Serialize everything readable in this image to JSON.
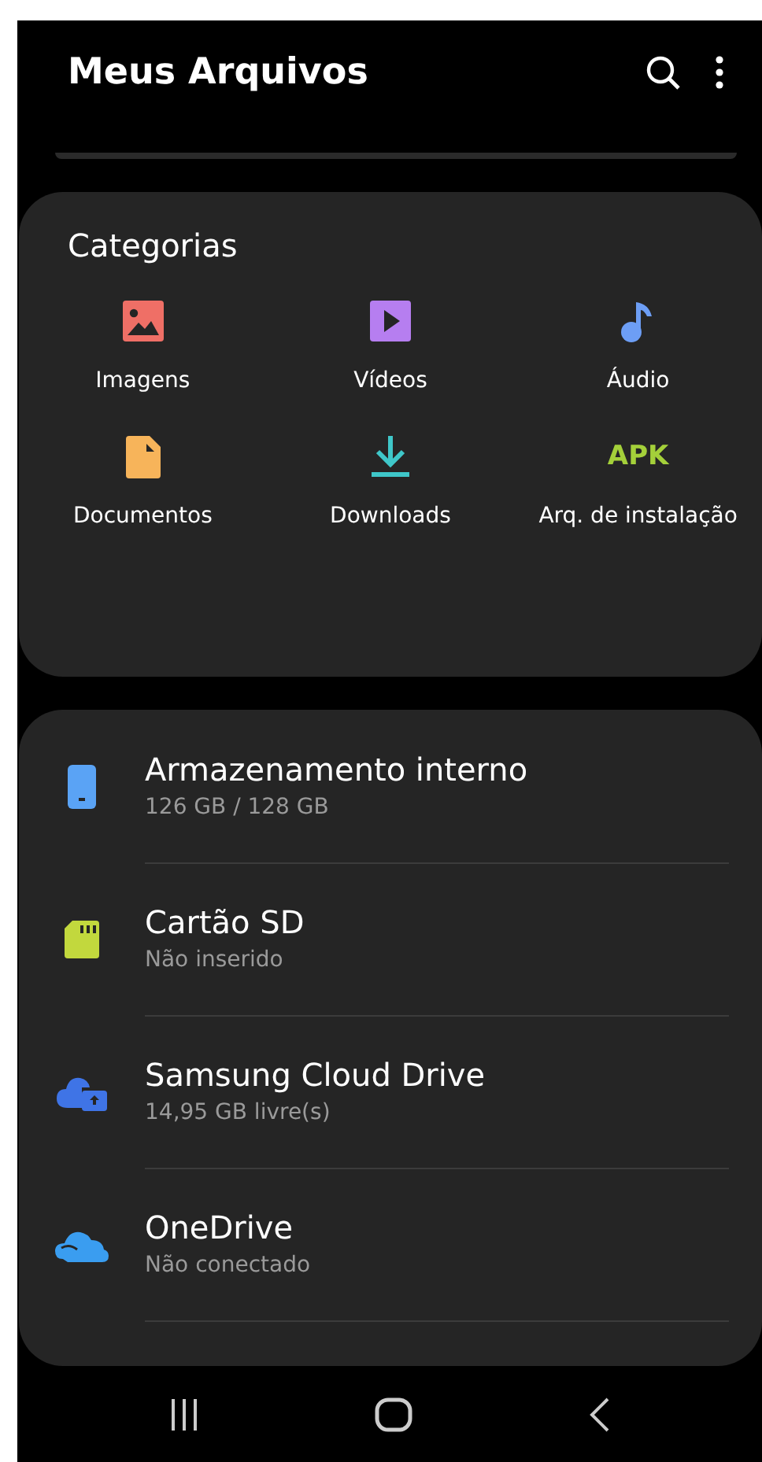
{
  "app_bar": {
    "title": "Meus Arquivos"
  },
  "categories": {
    "title": "Categorias",
    "items": [
      {
        "kind": "images",
        "label": "Imagens"
      },
      {
        "kind": "videos",
        "label": "Vídeos"
      },
      {
        "kind": "audio",
        "label": "Áudio"
      },
      {
        "kind": "documents",
        "label": "Documentos"
      },
      {
        "kind": "downloads",
        "label": "Downloads"
      },
      {
        "kind": "apk",
        "label": "Arq. de instalação",
        "badge": "APK"
      }
    ]
  },
  "storage": [
    {
      "kind": "phone",
      "name": "Armazenamento interno",
      "detail": "126 GB / 128 GB"
    },
    {
      "kind": "sd",
      "name": "Cartão SD",
      "detail": "Não inserido"
    },
    {
      "kind": "samsung_cloud",
      "name": "Samsung Cloud Drive",
      "detail": "14,95 GB livre(s)"
    },
    {
      "kind": "onedrive",
      "name": "OneDrive",
      "detail": "Não conectado"
    }
  ],
  "nav_bar": [
    {
      "kind": "recents"
    },
    {
      "kind": "home"
    },
    {
      "kind": "back"
    }
  ]
}
